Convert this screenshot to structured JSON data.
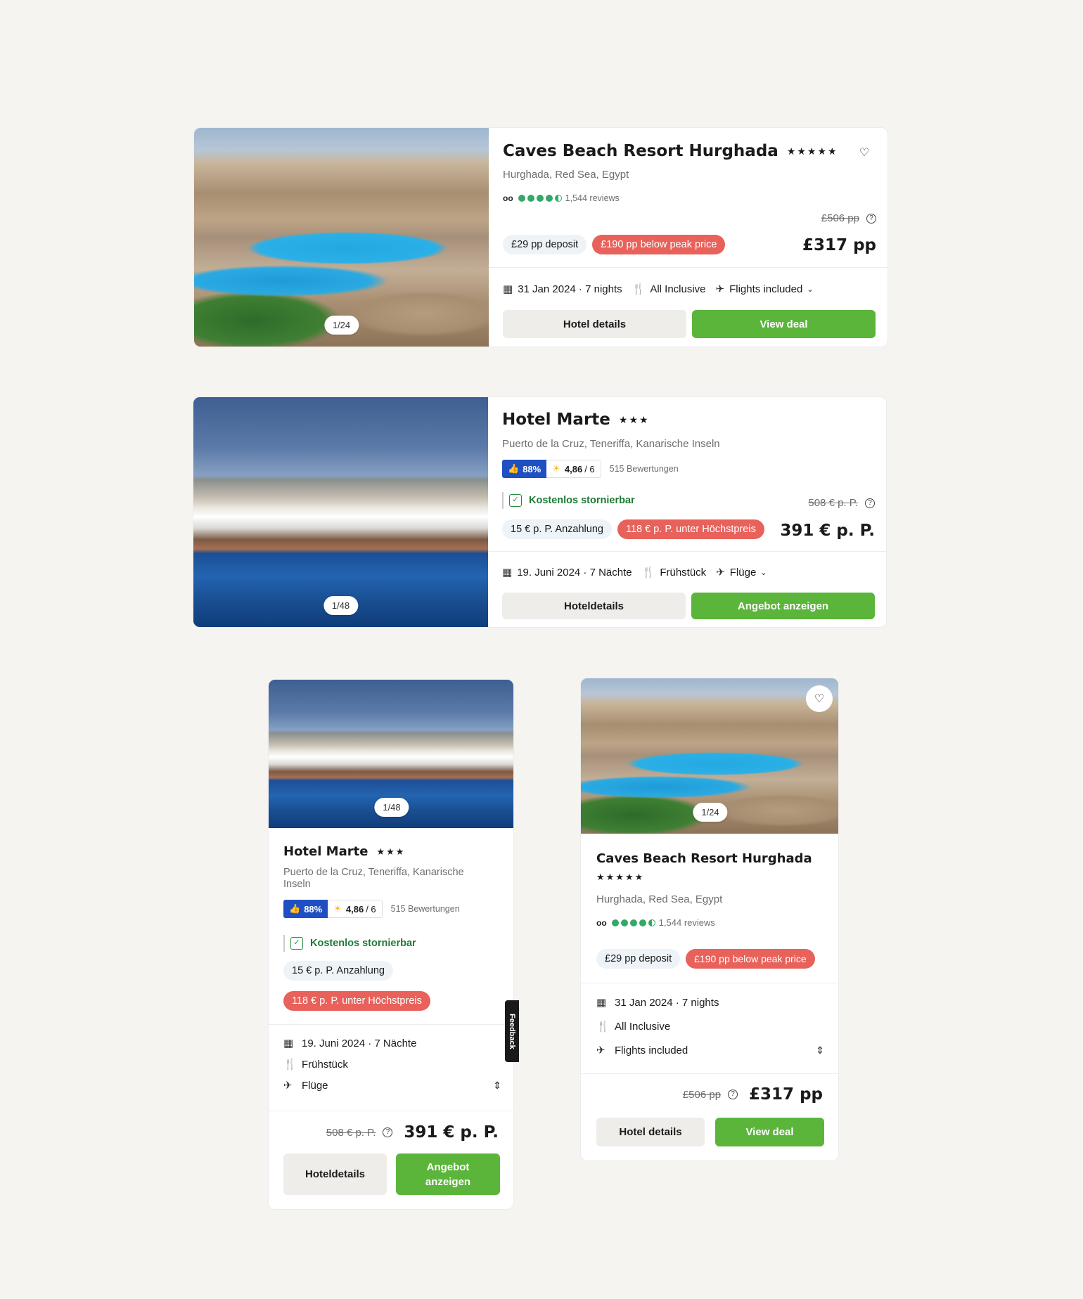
{
  "card1": {
    "photo_counter": "1/24",
    "title": "Caves Beach Resort Hurghada",
    "stars": "★★★★★",
    "location": "Hurghada, Red Sea, Egypt",
    "reviews": "1,544 reviews",
    "deposit": "£29 pp deposit",
    "peak": "£190 pp below peak price",
    "old_price": "£506 pp",
    "price": "£317 pp",
    "date": "31 Jan 2024 · 7 nights",
    "board": "All Inclusive",
    "flights": "Flights included",
    "details_button": "Hotel details",
    "deal_button": "View deal"
  },
  "card2": {
    "photo_counter": "1/48",
    "title": "Hotel Marte",
    "stars": "★★★",
    "location": "Puerto de la Cruz, Teneriffa, Kanarische Inseln",
    "recommend": "88%",
    "score": "4,86",
    "score_max": "/ 6",
    "reviews": "515 Bewertungen",
    "cancel": "Kostenlos stornierbar",
    "deposit": "15 € p. P. Anzahlung",
    "peak": "118 € p. P. unter Höchstpreis",
    "old_price": "508 € p. P.",
    "price": "391 € p. P.",
    "date": "19. Juni 2024 · 7 Nächte",
    "board": "Frühstück",
    "flights": "Flüge",
    "details_button": "Hoteldetails",
    "deal_button": "Angebot anzeigen"
  },
  "card3": {
    "photo_counter": "1/48",
    "title": "Hotel Marte",
    "stars": "★★★",
    "location": "Puerto de la Cruz, Teneriffa, Kanarische Inseln",
    "recommend": "88%",
    "score": "4,86",
    "score_max": "/ 6",
    "reviews": "515 Bewertungen",
    "cancel": "Kostenlos stornierbar",
    "deposit": "15 € p. P. Anzahlung",
    "peak": "118 € p. P. unter Höchstpreis",
    "date": "19. Juni 2024 · 7 Nächte",
    "board": "Frühstück",
    "flights": "Flüge",
    "old_price": "508 € p. P.",
    "price": "391 € p. P.",
    "details_button": "Hoteldetails",
    "deal_button": "Angebot anzeigen"
  },
  "card4": {
    "photo_counter": "1/24",
    "title": "Caves Beach Resort Hurghada",
    "stars": "★★★★★",
    "location": "Hurghada, Red Sea, Egypt",
    "reviews": "1,544 reviews",
    "deposit": "£29 pp deposit",
    "peak": "£190 pp below peak price",
    "date": "31 Jan 2024 · 7 nights",
    "board": "All Inclusive",
    "flights": "Flights included",
    "old_price": "£506 pp",
    "price": "£317 pp",
    "details_button": "Hotel details",
    "deal_button": "View deal"
  },
  "feedback_tab": "Feedback",
  "colors": {
    "green": "#5bb53a",
    "red": "#e8615a",
    "blue": "#1f4fc2",
    "tripadvisor": "#34a868"
  }
}
